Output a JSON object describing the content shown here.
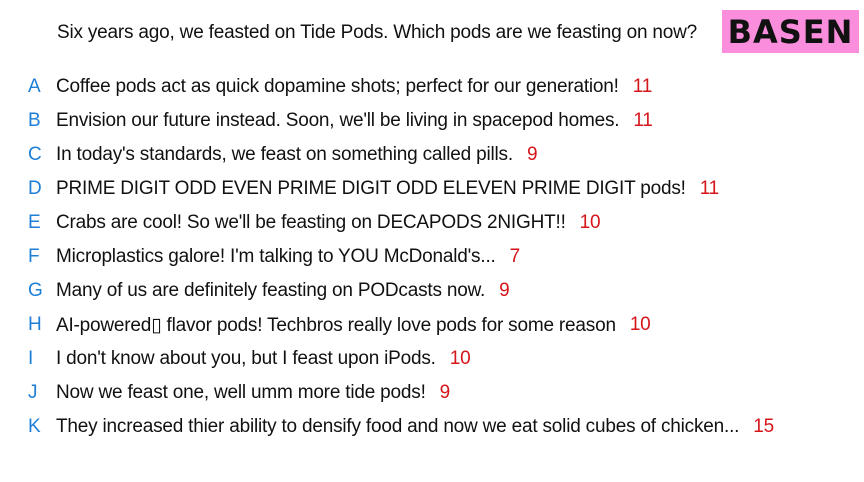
{
  "question": "Six years ago, we feasted on Tide Pods. Which pods are we feasting on now?",
  "badge": {
    "label": "BASEN",
    "background": "#fa8edd",
    "text_color": "#111111"
  },
  "colors": {
    "letter": "#1e7fd6",
    "count": "#d6151b",
    "text": "#111111"
  },
  "options": [
    {
      "letter": "A",
      "text": "Coffee pods act as quick dopamine shots; perfect for our generation!",
      "count": "11"
    },
    {
      "letter": "B",
      "text": "Envision our future instead. Soon, we'll be living in spacepod homes.",
      "count": "11"
    },
    {
      "letter": "C",
      "text": "In today's standards, we feast on something called pills.",
      "count": "9"
    },
    {
      "letter": "D",
      "text": "PRIME DIGIT ODD EVEN PRIME DIGIT ODD ELEVEN PRIME DIGIT pods!",
      "count": "11"
    },
    {
      "letter": "E",
      "text": "Crabs are cool! So we'll be feasting on DECAPODS 2NIGHT!!",
      "count": "10"
    },
    {
      "letter": "F",
      "text": "Microplastics galore! I'm talking to YOU McDonald's...",
      "count": "7"
    },
    {
      "letter": "G",
      "text": "Many of us are definitely feasting on PODcasts now.",
      "count": "9"
    },
    {
      "letter": "H",
      "text": "AI-powered▯ flavor pods! Techbros really love pods for some reason",
      "count": "10"
    },
    {
      "letter": "I",
      "text": "I don't know about you, but I feast upon iPods.",
      "count": "10"
    },
    {
      "letter": "J",
      "text": "Now we feast one, well umm more tide pods!",
      "count": "9"
    },
    {
      "letter": "K",
      "text": "They increased thier ability to densify food and now we eat solid cubes of chicken...",
      "count": "15"
    }
  ]
}
